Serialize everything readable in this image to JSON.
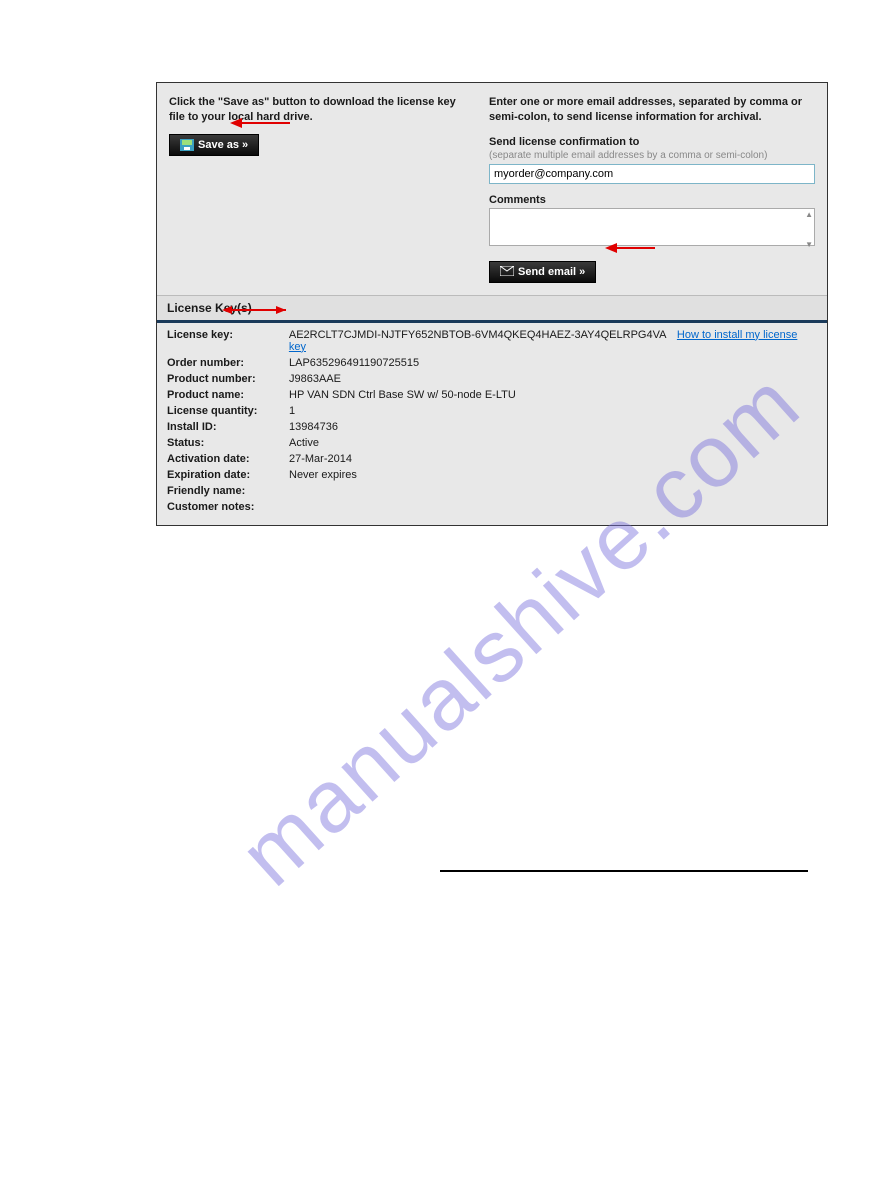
{
  "left": {
    "instruction": "Click the \"Save as\" button to download the license key file to your local hard drive.",
    "save_as_label": "Save as »"
  },
  "right": {
    "instruction": "Enter one or more email addresses, separated by comma or semi-colon, to send license information for archival.",
    "confirm_label": "Send license confirmation to",
    "confirm_hint": "(separate multiple email addresses by a comma or semi-colon)",
    "email_value": "myorder@company.com",
    "comments_label": "Comments",
    "send_email_label": "Send email »"
  },
  "keys_header": "License Key(s)",
  "details": {
    "license_key_label": "License key:",
    "license_key_value": "AE2RCLT7CJMDI-NJTFY652NBTOB-6VM4QKEQ4HAEZ-3AY4QELRPG4VA",
    "how_to_link": "How to install my license key",
    "order_number_label": "Order number:",
    "order_number_value": "LAP635296491190725515",
    "product_number_label": "Product number:",
    "product_number_value": "J9863AAE",
    "product_name_label": "Product name:",
    "product_name_value": "HP VAN SDN Ctrl Base SW w/ 50-node E-LTU",
    "license_quantity_label": "License quantity:",
    "license_quantity_value": "1",
    "install_id_label": "Install ID:",
    "install_id_value": "13984736",
    "status_label": "Status:",
    "status_value": "Active",
    "activation_date_label": "Activation date:",
    "activation_date_value": "27-Mar-2014",
    "expiration_date_label": "Expiration date:",
    "expiration_date_value": "Never expires",
    "friendly_name_label": "Friendly name:",
    "friendly_name_value": "",
    "customer_notes_label": "Customer notes:",
    "customer_notes_value": ""
  },
  "watermark": "manualshive.com"
}
